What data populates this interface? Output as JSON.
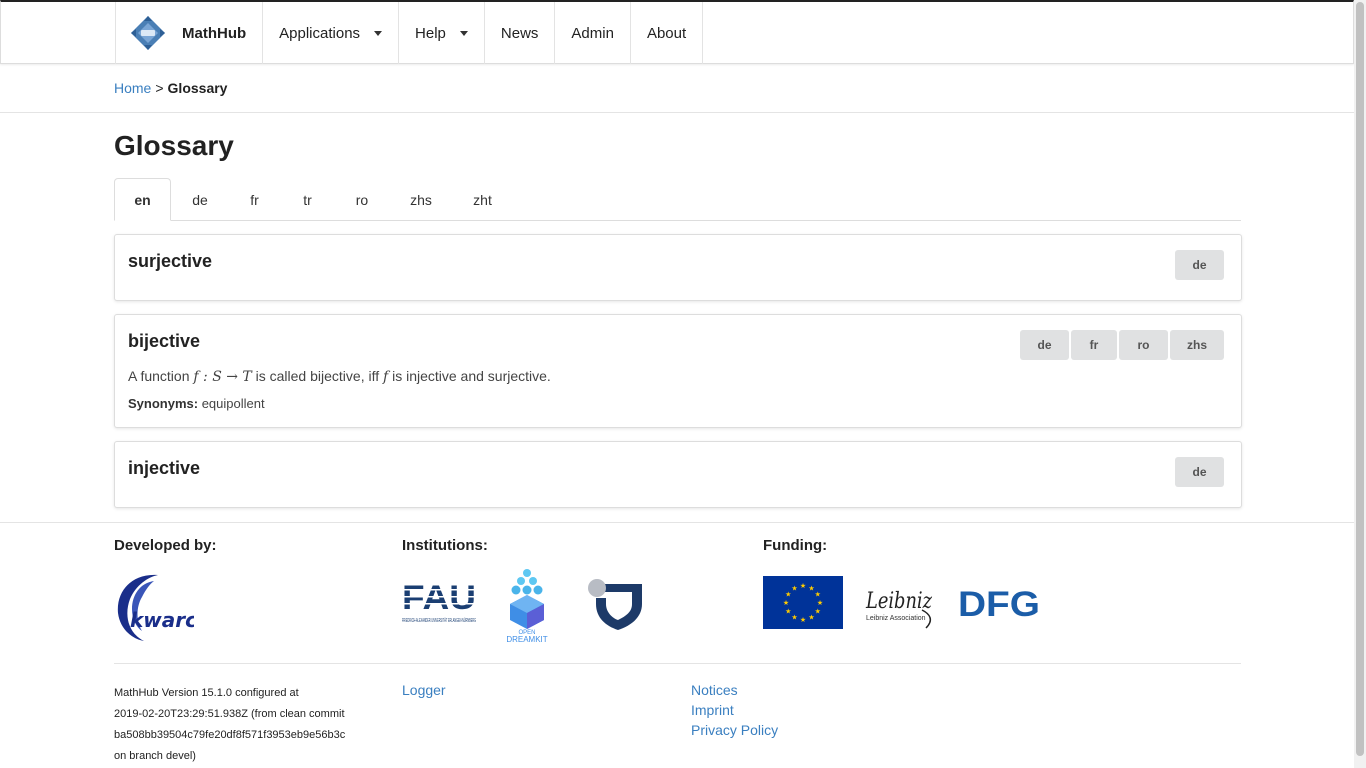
{
  "navbar": {
    "brand": "MathHub",
    "items": [
      {
        "label": "Applications"
      },
      {
        "label": "Help"
      },
      {
        "label": "News"
      },
      {
        "label": "Admin"
      },
      {
        "label": "About"
      }
    ]
  },
  "breadcrumb": {
    "home": "Home",
    "separator": ">",
    "current": "Glossary"
  },
  "page_title": "Glossary",
  "tabs": [
    "en",
    "de",
    "fr",
    "tr",
    "ro",
    "zhs",
    "zht"
  ],
  "active_tab": "en",
  "entries": [
    {
      "title": "surjective",
      "languages": [
        "de"
      ]
    },
    {
      "title": "bijective",
      "languages": [
        "de",
        "fr",
        "ro",
        "zhs"
      ],
      "description_pre": "A function",
      "math_1": "f : S → T",
      "description_mid": "is called bijective, iff",
      "math_2": "f",
      "description_post": "is injective and surjective.",
      "synonyms_label": "Synonyms:",
      "synonyms": "equipollent"
    },
    {
      "title": "injective",
      "languages": [
        "de"
      ]
    }
  ],
  "footer": {
    "developed_by": "Developed by:",
    "institutions": "Institutions:",
    "funding": "Funding:",
    "logos": {
      "kwarc": "kwarc",
      "fau": "FAU",
      "fau_sub": "FRIEDRICH-ALEXANDER UNIVERSITÄT ERLANGEN-NÜRNBERG",
      "odk_small": "OPEN",
      "odk": "DREAMKIT",
      "leibniz": "Leibniz",
      "leibniz_sub": "Leibniz Association",
      "dfg": "DFG"
    },
    "version_lines": [
      "MathHub Version 15.1.0 configured at",
      "2019-02-20T23:29:51.938Z (from clean commit",
      "ba508bb39504c79fe20df8f571f3953eb9e56b3c",
      "on branch devel)"
    ],
    "logger": "Logger",
    "notices": "Notices",
    "imprint": "Imprint",
    "privacy": "Privacy Policy"
  },
  "colors": {
    "link": "#3a7fc0",
    "logo_blue": "#4a7fb5",
    "eu_blue": "#003399",
    "eu_star": "#ffcc00",
    "dfg_blue": "#1b5da8",
    "kwarc_blue": "#1a2e8a"
  }
}
